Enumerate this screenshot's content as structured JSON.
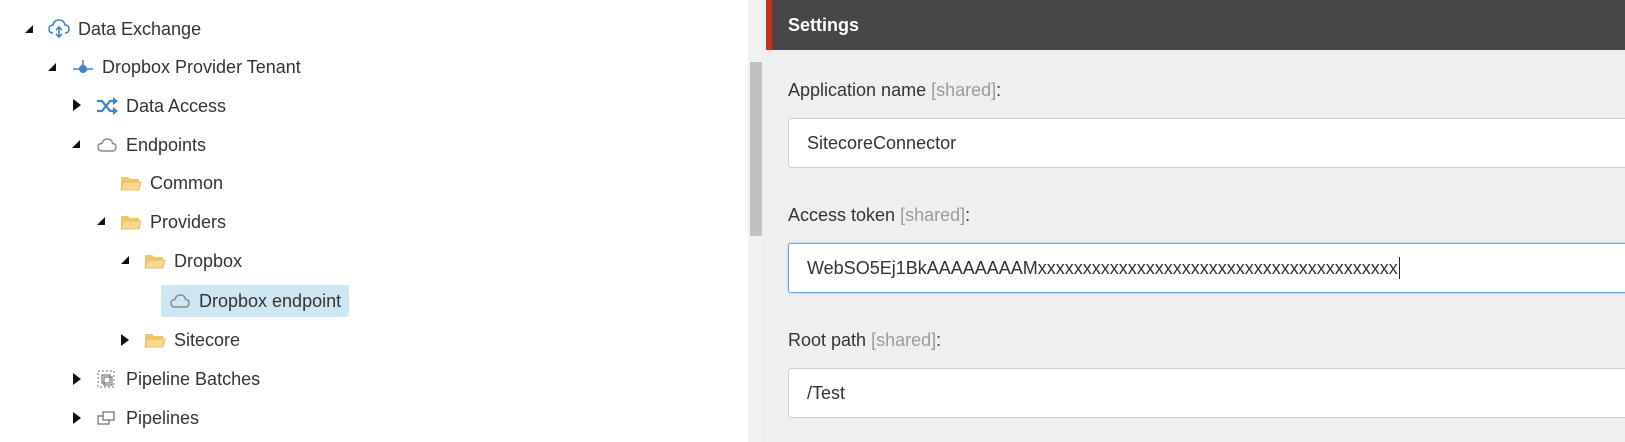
{
  "tree": {
    "items": [
      {
        "label": "Data Exchange",
        "icon": "data-exchange-cloud-icon",
        "arrow": "expanded"
      },
      {
        "label": "Dropbox Provider Tenant",
        "icon": "tenant-node-icon",
        "arrow": "expanded"
      },
      {
        "label": "Data Access",
        "icon": "shuffle-icon",
        "arrow": "collapsed"
      },
      {
        "label": "Endpoints",
        "icon": "cloud-icon",
        "arrow": "expanded"
      },
      {
        "label": "Common",
        "icon": "folder-icon",
        "arrow": "none"
      },
      {
        "label": "Providers",
        "icon": "folder-icon",
        "arrow": "expanded"
      },
      {
        "label": "Dropbox",
        "icon": "folder-icon",
        "arrow": "expanded"
      },
      {
        "label": "Dropbox endpoint",
        "icon": "cloud-icon",
        "arrow": "none",
        "selected": true
      },
      {
        "label": "Sitecore",
        "icon": "folder-icon",
        "arrow": "collapsed"
      },
      {
        "label": "Pipeline Batches",
        "icon": "pipeline-batches-icon",
        "arrow": "collapsed"
      },
      {
        "label": "Pipelines",
        "icon": "pipelines-icon",
        "arrow": "collapsed"
      }
    ]
  },
  "settings": {
    "header": "Settings",
    "fields": [
      {
        "label": "Application name",
        "shared": "[shared]",
        "suffix": ":",
        "value": "SitecoreConnector"
      },
      {
        "label": "Access token",
        "shared": "[shared]",
        "suffix": ":",
        "value": "WebSO5Ej1BkAAAAAAAAMxxxxxxxxxxxxxxxxxxxxxxxxxxxxxxxxxxxxxxxx",
        "focused": true
      },
      {
        "label": "Root path",
        "shared": "[shared]",
        "suffix": ":",
        "value": "/Test"
      }
    ]
  },
  "colors": {
    "header_bg": "#474747",
    "header_accent": "#c3311f",
    "selection_bg": "#cfe6f3",
    "folder": "#f3c46a",
    "icon_blue": "#3f86c8"
  }
}
